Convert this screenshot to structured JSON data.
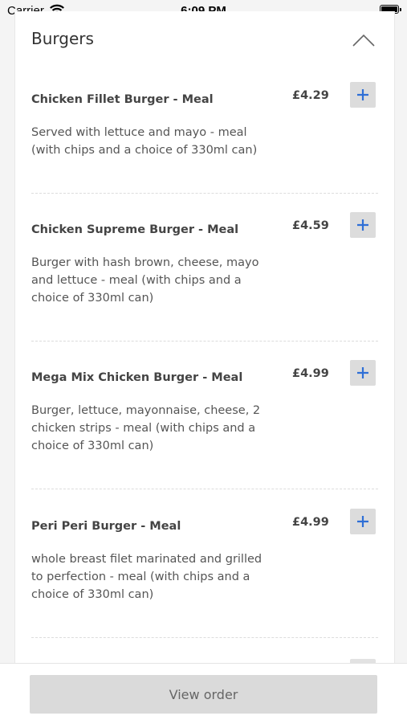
{
  "status_bar": {
    "carrier": "Carrier",
    "time": "6:09 PM"
  },
  "section": {
    "title": "Burgers",
    "collapse_icon": "chevron-up-icon"
  },
  "items": [
    {
      "name": "Chicken Fillet Burger - Meal",
      "price": "£4.29",
      "description": "Served with lettuce and mayo - meal (with chips and a choice of 330ml can)"
    },
    {
      "name": "Chicken Supreme Burger - Meal",
      "price": "£4.59",
      "description": "Burger with hash brown, cheese, mayo and lettuce - meal (with chips and a choice of 330ml can)"
    },
    {
      "name": "Mega Mix Chicken Burger - Meal",
      "price": "£4.99",
      "description": "Burger, lettuce, mayonnaise, cheese, 2 chicken strips - meal (with chips and a choice of 330ml can)"
    },
    {
      "name": "Peri Peri Burger - Meal",
      "price": "£4.99",
      "description": "whole breast filet marinated and grilled to perfection - meal (with chips and a choice of 330ml can)"
    }
  ],
  "bottom": {
    "view_order_label": "View order"
  },
  "colors": {
    "accent": "#2f6fd6",
    "button_bg": "#dcdcdc",
    "background": "#f4f4f4"
  }
}
